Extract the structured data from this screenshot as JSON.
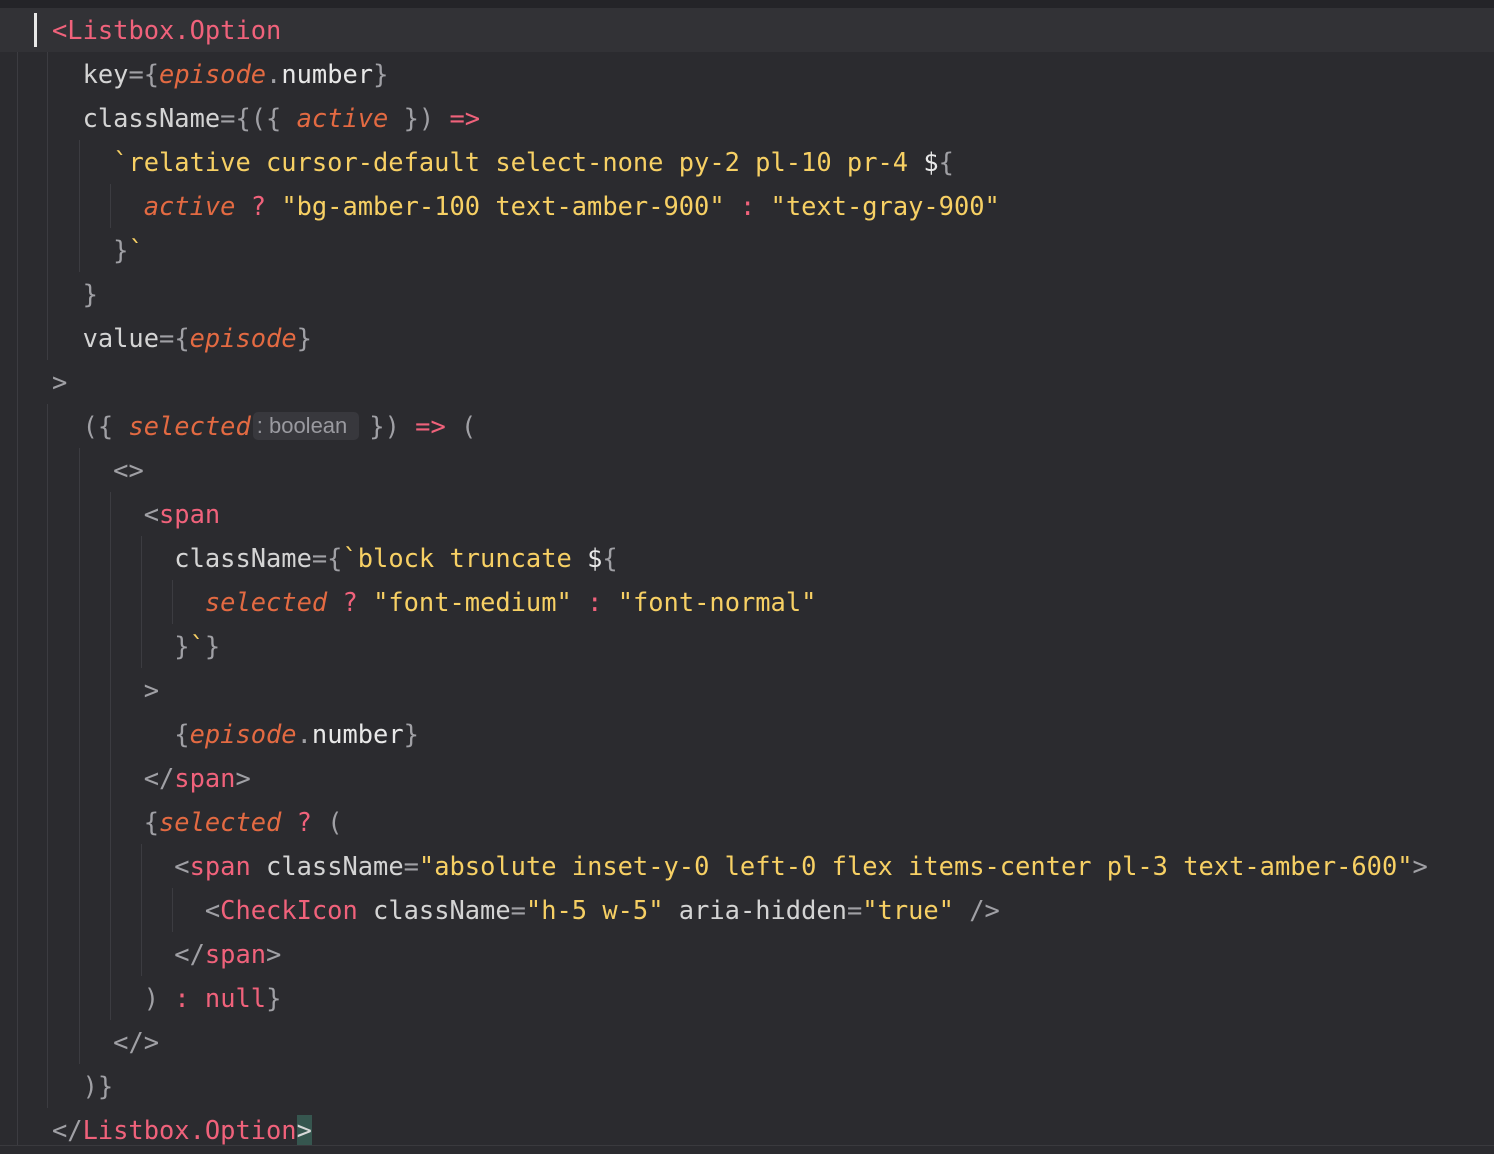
{
  "editor": {
    "lines": [
      [
        [
          "tag",
          "<"
        ],
        [
          "tag",
          "Listbox.Option"
        ]
      ],
      [
        [
          "sp",
          "  "
        ],
        [
          "attr",
          "key"
        ],
        [
          "pun",
          "="
        ],
        [
          "pun",
          "{"
        ],
        [
          "par",
          "episode"
        ],
        [
          "pun",
          "."
        ],
        [
          "prop",
          "number"
        ],
        [
          "pun",
          "}"
        ]
      ],
      [
        [
          "sp",
          "  "
        ],
        [
          "attr",
          "className"
        ],
        [
          "pun",
          "="
        ],
        [
          "pun",
          "{"
        ],
        [
          "pun",
          "("
        ],
        [
          "pun",
          "{ "
        ],
        [
          "par",
          "active"
        ],
        [
          "pun",
          " }"
        ],
        [
          "pun",
          ")"
        ],
        [
          "sp",
          " "
        ],
        [
          "op",
          "=>"
        ]
      ],
      [
        [
          "sp",
          "    "
        ],
        [
          "str",
          "`relative cursor-default select-none py-2 pl-10 pr-4 "
        ],
        [
          "prop",
          "$"
        ],
        [
          "pun",
          "{"
        ]
      ],
      [
        [
          "sp",
          "      "
        ],
        [
          "par",
          "active"
        ],
        [
          "sp",
          " "
        ],
        [
          "op",
          "?"
        ],
        [
          "sp",
          " "
        ],
        [
          "str",
          "\"bg-amber-100 text-amber-900\""
        ],
        [
          "sp",
          " "
        ],
        [
          "op",
          ":"
        ],
        [
          "sp",
          " "
        ],
        [
          "str",
          "\"text-gray-900\""
        ]
      ],
      [
        [
          "sp",
          "    "
        ],
        [
          "pun",
          "}"
        ],
        [
          "str",
          "`"
        ]
      ],
      [
        [
          "sp",
          "  "
        ],
        [
          "pun",
          "}"
        ]
      ],
      [
        [
          "sp",
          "  "
        ],
        [
          "attr",
          "value"
        ],
        [
          "pun",
          "="
        ],
        [
          "pun",
          "{"
        ],
        [
          "par",
          "episode"
        ],
        [
          "pun",
          "}"
        ]
      ],
      [
        [
          "pun",
          ">"
        ]
      ],
      [
        [
          "sp",
          "  "
        ],
        [
          "pun",
          "({"
        ],
        [
          "sp",
          " "
        ],
        [
          "par",
          "selected"
        ],
        [
          "hint",
          ": boolean"
        ],
        [
          "pun",
          "})"
        ],
        [
          "sp",
          " "
        ],
        [
          "op",
          "=>"
        ],
        [
          "sp",
          " "
        ],
        [
          "pun",
          "("
        ]
      ],
      [
        [
          "sp",
          "    "
        ],
        [
          "pun",
          "<>"
        ]
      ],
      [
        [
          "sp",
          "      "
        ],
        [
          "pun",
          "<"
        ],
        [
          "tag",
          "span"
        ]
      ],
      [
        [
          "sp",
          "        "
        ],
        [
          "attr",
          "className"
        ],
        [
          "pun",
          "="
        ],
        [
          "pun",
          "{"
        ],
        [
          "str",
          "`block truncate "
        ],
        [
          "prop",
          "$"
        ],
        [
          "pun",
          "{"
        ]
      ],
      [
        [
          "sp",
          "          "
        ],
        [
          "par",
          "selected"
        ],
        [
          "sp",
          " "
        ],
        [
          "op",
          "?"
        ],
        [
          "sp",
          " "
        ],
        [
          "str",
          "\"font-medium\""
        ],
        [
          "sp",
          " "
        ],
        [
          "op",
          ":"
        ],
        [
          "sp",
          " "
        ],
        [
          "str",
          "\"font-normal\""
        ]
      ],
      [
        [
          "sp",
          "        "
        ],
        [
          "pun",
          "}"
        ],
        [
          "str",
          "`"
        ],
        [
          "pun",
          "}"
        ]
      ],
      [
        [
          "sp",
          "      "
        ],
        [
          "pun",
          ">"
        ]
      ],
      [
        [
          "sp",
          "        "
        ],
        [
          "pun",
          "{"
        ],
        [
          "par",
          "episode"
        ],
        [
          "pun",
          "."
        ],
        [
          "prop",
          "number"
        ],
        [
          "pun",
          "}"
        ]
      ],
      [
        [
          "sp",
          "      "
        ],
        [
          "pun",
          "</"
        ],
        [
          "tag",
          "span"
        ],
        [
          "pun",
          ">"
        ]
      ],
      [
        [
          "sp",
          "      "
        ],
        [
          "pun",
          "{"
        ],
        [
          "par",
          "selected"
        ],
        [
          "sp",
          " "
        ],
        [
          "op",
          "?"
        ],
        [
          "sp",
          " "
        ],
        [
          "pun",
          "("
        ]
      ],
      [
        [
          "sp",
          "        "
        ],
        [
          "pun",
          "<"
        ],
        [
          "tag",
          "span"
        ],
        [
          "sp",
          " "
        ],
        [
          "attr",
          "className"
        ],
        [
          "pun",
          "="
        ],
        [
          "str",
          "\"absolute inset-y-0 left-0 flex items-center pl-3 text-amber-600\""
        ],
        [
          "pun",
          ">"
        ]
      ],
      [
        [
          "sp",
          "          "
        ],
        [
          "pun",
          "<"
        ],
        [
          "tag",
          "CheckIcon"
        ],
        [
          "sp",
          " "
        ],
        [
          "attr",
          "className"
        ],
        [
          "pun",
          "="
        ],
        [
          "str",
          "\"h-5 w-5\""
        ],
        [
          "sp",
          " "
        ],
        [
          "attr",
          "aria-hidden"
        ],
        [
          "pun",
          "="
        ],
        [
          "str",
          "\"true\""
        ],
        [
          "sp",
          " "
        ],
        [
          "pun",
          "/>"
        ]
      ],
      [
        [
          "sp",
          "        "
        ],
        [
          "pun",
          "</"
        ],
        [
          "tag",
          "span"
        ],
        [
          "pun",
          ">"
        ]
      ],
      [
        [
          "sp",
          "      "
        ],
        [
          "pun",
          ")"
        ],
        [
          "sp",
          " "
        ],
        [
          "op",
          ":"
        ],
        [
          "sp",
          " "
        ],
        [
          "kw",
          "null"
        ],
        [
          "pun",
          "}"
        ]
      ],
      [
        [
          "sp",
          "    "
        ],
        [
          "pun",
          "</>"
        ]
      ],
      [
        [
          "sp",
          "  "
        ],
        [
          "pun",
          ")}"
        ]
      ],
      [
        [
          "pun",
          "</"
        ],
        [
          "tag",
          "Listbox.Option"
        ],
        [
          "match",
          ">"
        ]
      ]
    ]
  }
}
